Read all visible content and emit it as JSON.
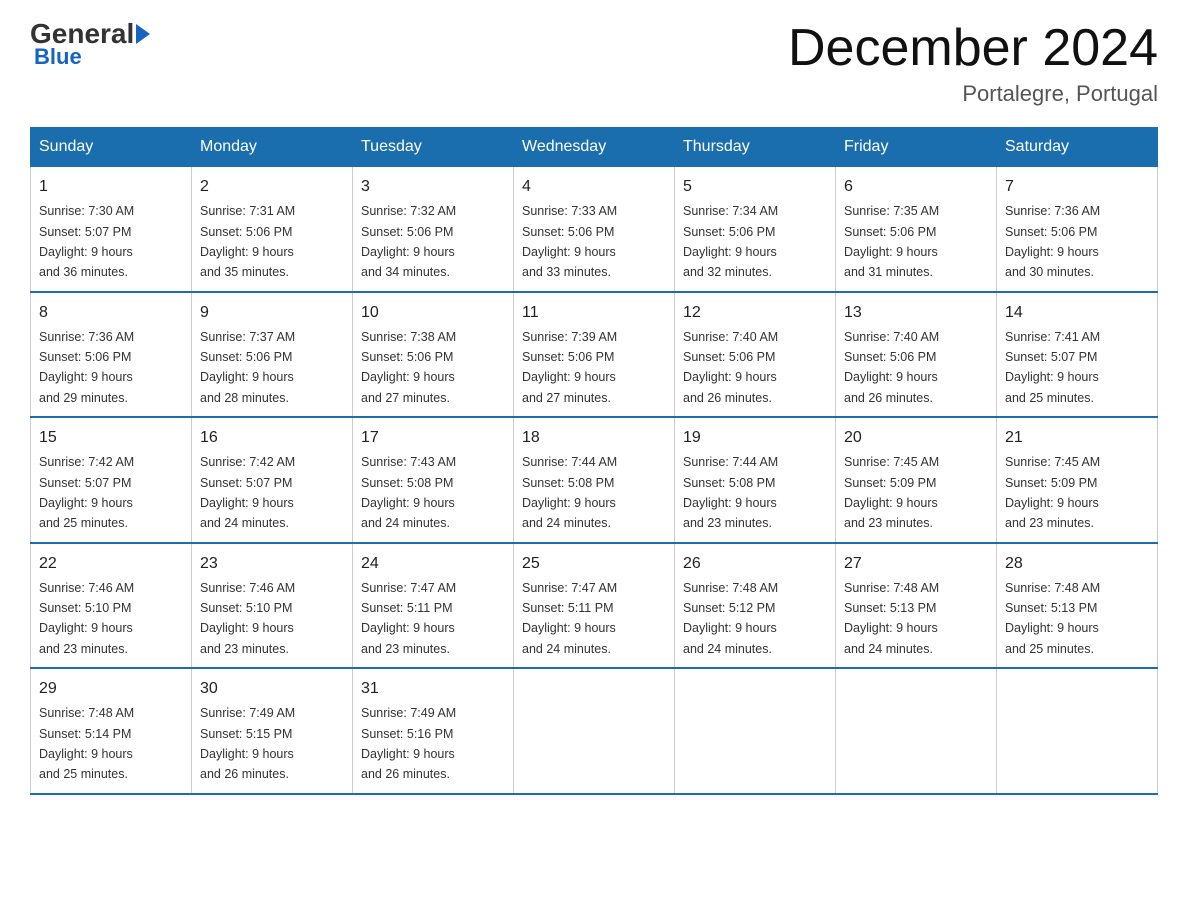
{
  "logo": {
    "general": "General",
    "blue": "Blue"
  },
  "header": {
    "month": "December 2024",
    "location": "Portalegre, Portugal"
  },
  "weekdays": [
    "Sunday",
    "Monday",
    "Tuesday",
    "Wednesday",
    "Thursday",
    "Friday",
    "Saturday"
  ],
  "weeks": [
    [
      {
        "day": "1",
        "sunrise": "7:30 AM",
        "sunset": "5:07 PM",
        "daylight": "9 hours and 36 minutes."
      },
      {
        "day": "2",
        "sunrise": "7:31 AM",
        "sunset": "5:06 PM",
        "daylight": "9 hours and 35 minutes."
      },
      {
        "day": "3",
        "sunrise": "7:32 AM",
        "sunset": "5:06 PM",
        "daylight": "9 hours and 34 minutes."
      },
      {
        "day": "4",
        "sunrise": "7:33 AM",
        "sunset": "5:06 PM",
        "daylight": "9 hours and 33 minutes."
      },
      {
        "day": "5",
        "sunrise": "7:34 AM",
        "sunset": "5:06 PM",
        "daylight": "9 hours and 32 minutes."
      },
      {
        "day": "6",
        "sunrise": "7:35 AM",
        "sunset": "5:06 PM",
        "daylight": "9 hours and 31 minutes."
      },
      {
        "day": "7",
        "sunrise": "7:36 AM",
        "sunset": "5:06 PM",
        "daylight": "9 hours and 30 minutes."
      }
    ],
    [
      {
        "day": "8",
        "sunrise": "7:36 AM",
        "sunset": "5:06 PM",
        "daylight": "9 hours and 29 minutes."
      },
      {
        "day": "9",
        "sunrise": "7:37 AM",
        "sunset": "5:06 PM",
        "daylight": "9 hours and 28 minutes."
      },
      {
        "day": "10",
        "sunrise": "7:38 AM",
        "sunset": "5:06 PM",
        "daylight": "9 hours and 27 minutes."
      },
      {
        "day": "11",
        "sunrise": "7:39 AM",
        "sunset": "5:06 PM",
        "daylight": "9 hours and 27 minutes."
      },
      {
        "day": "12",
        "sunrise": "7:40 AM",
        "sunset": "5:06 PM",
        "daylight": "9 hours and 26 minutes."
      },
      {
        "day": "13",
        "sunrise": "7:40 AM",
        "sunset": "5:06 PM",
        "daylight": "9 hours and 26 minutes."
      },
      {
        "day": "14",
        "sunrise": "7:41 AM",
        "sunset": "5:07 PM",
        "daylight": "9 hours and 25 minutes."
      }
    ],
    [
      {
        "day": "15",
        "sunrise": "7:42 AM",
        "sunset": "5:07 PM",
        "daylight": "9 hours and 25 minutes."
      },
      {
        "day": "16",
        "sunrise": "7:42 AM",
        "sunset": "5:07 PM",
        "daylight": "9 hours and 24 minutes."
      },
      {
        "day": "17",
        "sunrise": "7:43 AM",
        "sunset": "5:08 PM",
        "daylight": "9 hours and 24 minutes."
      },
      {
        "day": "18",
        "sunrise": "7:44 AM",
        "sunset": "5:08 PM",
        "daylight": "9 hours and 24 minutes."
      },
      {
        "day": "19",
        "sunrise": "7:44 AM",
        "sunset": "5:08 PM",
        "daylight": "9 hours and 23 minutes."
      },
      {
        "day": "20",
        "sunrise": "7:45 AM",
        "sunset": "5:09 PM",
        "daylight": "9 hours and 23 minutes."
      },
      {
        "day": "21",
        "sunrise": "7:45 AM",
        "sunset": "5:09 PM",
        "daylight": "9 hours and 23 minutes."
      }
    ],
    [
      {
        "day": "22",
        "sunrise": "7:46 AM",
        "sunset": "5:10 PM",
        "daylight": "9 hours and 23 minutes."
      },
      {
        "day": "23",
        "sunrise": "7:46 AM",
        "sunset": "5:10 PM",
        "daylight": "9 hours and 23 minutes."
      },
      {
        "day": "24",
        "sunrise": "7:47 AM",
        "sunset": "5:11 PM",
        "daylight": "9 hours and 23 minutes."
      },
      {
        "day": "25",
        "sunrise": "7:47 AM",
        "sunset": "5:11 PM",
        "daylight": "9 hours and 24 minutes."
      },
      {
        "day": "26",
        "sunrise": "7:48 AM",
        "sunset": "5:12 PM",
        "daylight": "9 hours and 24 minutes."
      },
      {
        "day": "27",
        "sunrise": "7:48 AM",
        "sunset": "5:13 PM",
        "daylight": "9 hours and 24 minutes."
      },
      {
        "day": "28",
        "sunrise": "7:48 AM",
        "sunset": "5:13 PM",
        "daylight": "9 hours and 25 minutes."
      }
    ],
    [
      {
        "day": "29",
        "sunrise": "7:48 AM",
        "sunset": "5:14 PM",
        "daylight": "9 hours and 25 minutes."
      },
      {
        "day": "30",
        "sunrise": "7:49 AM",
        "sunset": "5:15 PM",
        "daylight": "9 hours and 26 minutes."
      },
      {
        "day": "31",
        "sunrise": "7:49 AM",
        "sunset": "5:16 PM",
        "daylight": "9 hours and 26 minutes."
      },
      null,
      null,
      null,
      null
    ]
  ],
  "labels": {
    "sunrise": "Sunrise:",
    "sunset": "Sunset:",
    "daylight": "Daylight:"
  }
}
